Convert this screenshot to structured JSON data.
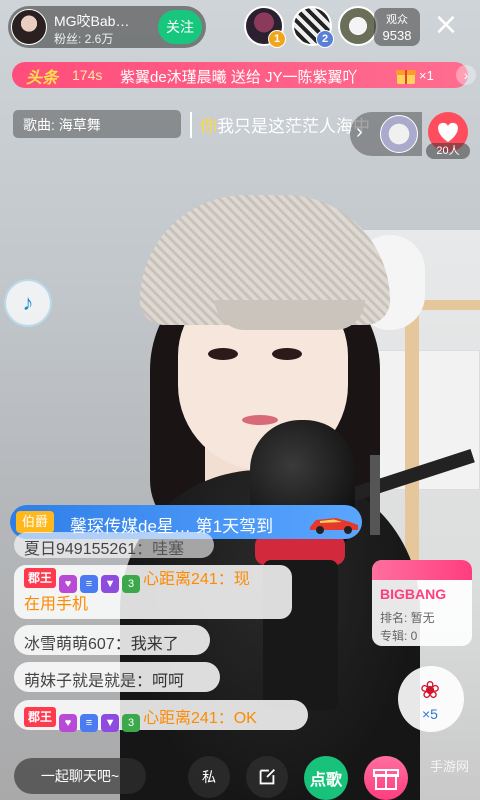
{
  "host": {
    "name": "MG咬Bab…",
    "fans": "粉丝: 2.6万",
    "follow_label": "关注"
  },
  "top_viewers": [
    {
      "rank": "1",
      "color": "#f0a51a"
    },
    {
      "rank": "2",
      "color": "#5a7fd8"
    }
  ],
  "viewers": {
    "label": "观众",
    "count": "9538"
  },
  "headline": {
    "tag": "头条",
    "seconds": "174s",
    "message": "紫翼de沐瑾晨曦 送给 JY一陈紫翼吖",
    "gift_count": "×1"
  },
  "song": {
    "label": "歌曲: 海草舞"
  },
  "lyrics": {
    "highlight": "你",
    "rest": "我只是这茫茫人海中"
  },
  "hearts": {
    "count": "20人"
  },
  "enter_notice": {
    "rank_tag": "伯爵",
    "message": "馨琛传媒de星… 第1天驾到"
  },
  "chat": [
    {
      "user": "夏日949155261",
      "sep": "：",
      "text": "哇塞"
    },
    {
      "tag": "郡王",
      "level": "3",
      "user": "心距离241",
      "sep": "：",
      "text_line1": "现",
      "text_line2": "在用手机"
    },
    {
      "user": "冰雪萌萌607",
      "sep": "：",
      "text": "我来了"
    },
    {
      "user": "萌妹子就是就是",
      "sep": "：",
      "text": "呵呵"
    },
    {
      "tag": "郡王",
      "level": "3",
      "user": "心距离241",
      "sep": "：",
      "text": "OK"
    }
  ],
  "song_card": {
    "title": "BIGBANG",
    "rank": "排名: 暂无",
    "album": "专辑: 0"
  },
  "rose": {
    "count": "×5"
  },
  "bottom": {
    "chat_placeholder": "一起聊天吧~",
    "private_label": "私",
    "song_label": "点歌"
  },
  "watermark": "手游网",
  "colors": {
    "accent_green": "#18c77e",
    "headline_pink": "#ff4d7c",
    "king_red": "#ff3a4f",
    "level_orange": "#ff8a00"
  }
}
